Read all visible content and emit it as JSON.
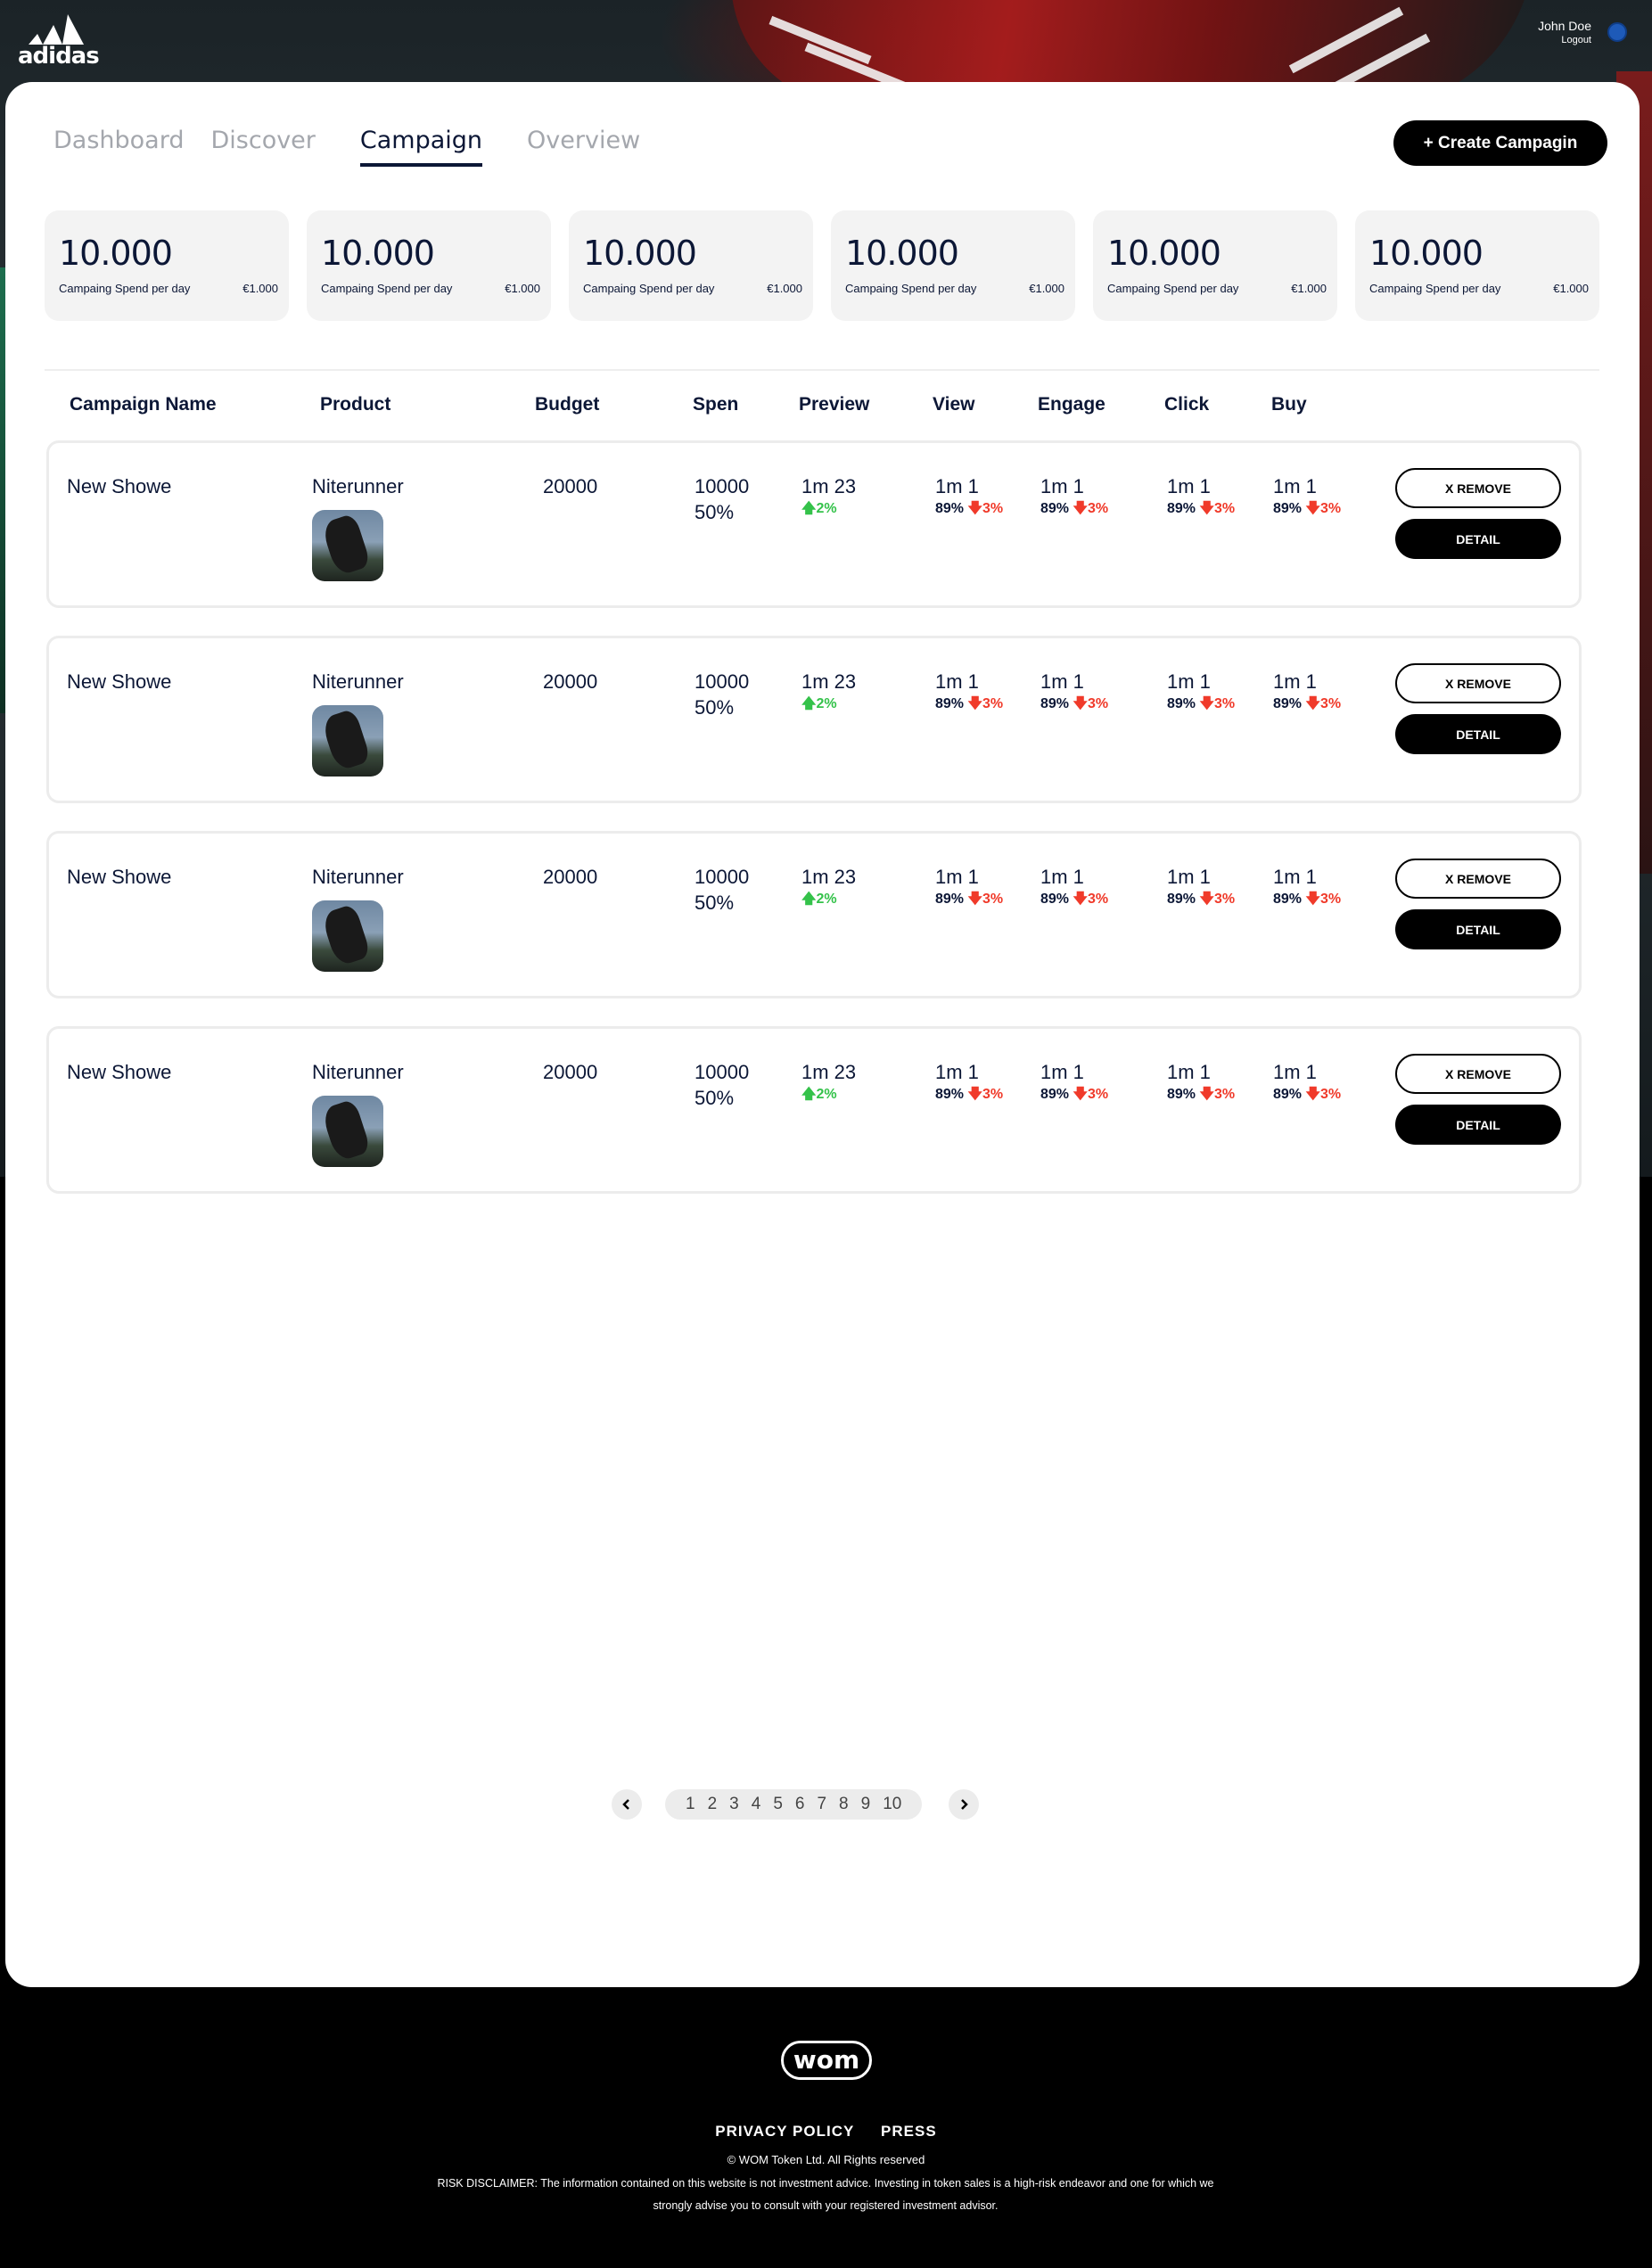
{
  "brand": {
    "name": "adidas"
  },
  "user": {
    "name": "John Doe",
    "logout": "Logout"
  },
  "tabs": [
    "Dashboard",
    "Discover",
    "Campaign",
    "Overview"
  ],
  "active_tab": "Campaign",
  "create_button": "+ Create Campagin",
  "stats": [
    {
      "value": "10.000",
      "label": "Campaing Spend per day",
      "amount": "€1.000"
    },
    {
      "value": "10.000",
      "label": "Campaing Spend per day",
      "amount": "€1.000"
    },
    {
      "value": "10.000",
      "label": "Campaing Spend per day",
      "amount": "€1.000"
    },
    {
      "value": "10.000",
      "label": "Campaing Spend per day",
      "amount": "€1.000"
    },
    {
      "value": "10.000",
      "label": "Campaing Spend per day",
      "amount": "€1.000"
    },
    {
      "value": "10.000",
      "label": "Campaing Spend per day",
      "amount": "€1.000"
    }
  ],
  "table": {
    "columns": [
      "Campaign Name",
      "Product",
      "Budget",
      "Spen",
      "Preview",
      "View",
      "Engage",
      "Click",
      "Buy"
    ],
    "rows": [
      {
        "name": "New Showe",
        "product": "Niterunner",
        "budget": "20000",
        "spend": "10000",
        "spend_pct": "50%",
        "preview": "1m 23",
        "preview_change": "2%",
        "view": "1m 1",
        "view_pct": "89%",
        "view_change": "3%",
        "engage": "1m 1",
        "engage_pct": "89%",
        "engage_change": "3%",
        "click": "1m 1",
        "click_pct": "89%",
        "click_change": "3%",
        "buy": "1m 1",
        "buy_pct": "89%",
        "buy_change": "3%",
        "remove_label": "X REMOVE",
        "detail_label": "DETAIL"
      },
      {
        "name": "New Showe",
        "product": "Niterunner",
        "budget": "20000",
        "spend": "10000",
        "spend_pct": "50%",
        "preview": "1m 23",
        "preview_change": "2%",
        "view": "1m 1",
        "view_pct": "89%",
        "view_change": "3%",
        "engage": "1m 1",
        "engage_pct": "89%",
        "engage_change": "3%",
        "click": "1m 1",
        "click_pct": "89%",
        "click_change": "3%",
        "buy": "1m 1",
        "buy_pct": "89%",
        "buy_change": "3%",
        "remove_label": "X REMOVE",
        "detail_label": "DETAIL"
      },
      {
        "name": "New Showe",
        "product": "Niterunner",
        "budget": "20000",
        "spend": "10000",
        "spend_pct": "50%",
        "preview": "1m 23",
        "preview_change": "2%",
        "view": "1m 1",
        "view_pct": "89%",
        "view_change": "3%",
        "engage": "1m 1",
        "engage_pct": "89%",
        "engage_change": "3%",
        "click": "1m 1",
        "click_pct": "89%",
        "click_change": "3%",
        "buy": "1m 1",
        "buy_pct": "89%",
        "buy_change": "3%",
        "remove_label": "X REMOVE",
        "detail_label": "DETAIL"
      },
      {
        "name": "New Showe",
        "product": "Niterunner",
        "budget": "20000",
        "spend": "10000",
        "spend_pct": "50%",
        "preview": "1m 23",
        "preview_change": "2%",
        "view": "1m 1",
        "view_pct": "89%",
        "view_change": "3%",
        "engage": "1m 1",
        "engage_pct": "89%",
        "engage_change": "3%",
        "click": "1m 1",
        "click_pct": "89%",
        "click_change": "3%",
        "buy": "1m 1",
        "buy_pct": "89%",
        "buy_change": "3%",
        "remove_label": "X REMOVE",
        "detail_label": "DETAIL"
      }
    ]
  },
  "pagination": {
    "pages": [
      "1",
      "2",
      "3",
      "4",
      "5",
      "6",
      "7",
      "8",
      "9",
      "10"
    ],
    "prev_icon": "chevron-left-icon",
    "next_icon": "chevron-right-icon"
  },
  "footer": {
    "logo": "wom",
    "links": [
      "PRIVACY POLICY",
      "PRESS"
    ],
    "copyright": "© WOM Token Ltd. All Rights reserved",
    "disclaimer": "RISK DISCLAIMER: The information contained on this website is not investment advice. Investing in token sales is a high-risk endeavor and one for which we strongly advise you to consult with your registered investment advisor."
  },
  "colors": {
    "accent": "#0c1736",
    "up": "#34c24a",
    "down": "#f03a2a",
    "button": "#000000"
  }
}
